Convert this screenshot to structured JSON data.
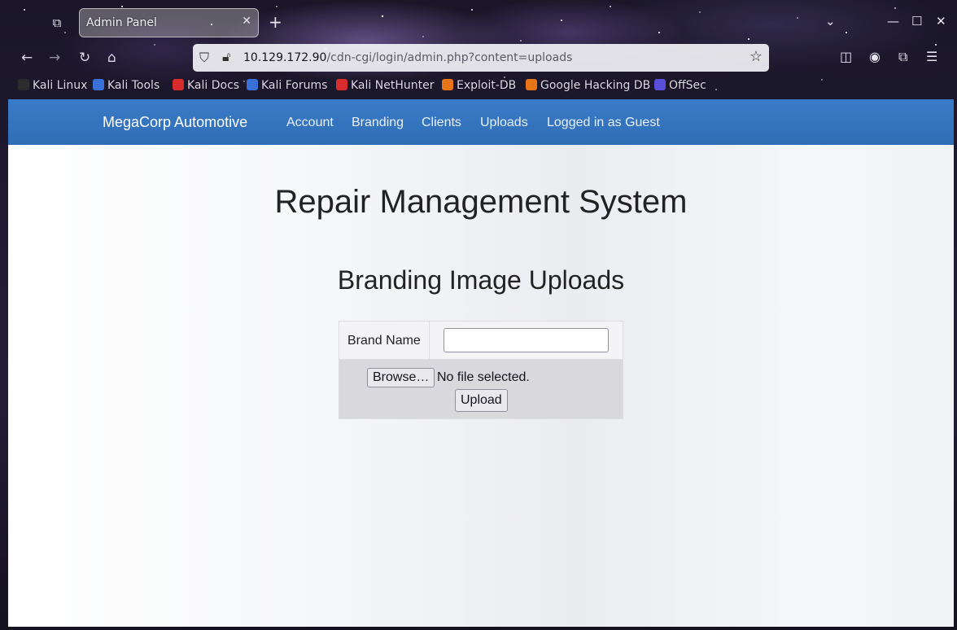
{
  "browser": {
    "tab_title": "Admin Panel",
    "tab_close": "✕",
    "new_tab": "+",
    "url_host": "10.129.172.90",
    "url_path": "/cdn-cgi/login/admin.php?content=uploads",
    "bookmarks": [
      {
        "label": "Kali Linux",
        "color": "#2c2c2c"
      },
      {
        "label": "Kali Tools",
        "color": "#3a6fd8"
      },
      {
        "label": "Kali Docs",
        "color": "#d82c2c"
      },
      {
        "label": "Kali Forums",
        "color": "#3a6fd8"
      },
      {
        "label": "Kali NetHunter",
        "color": "#d82c2c"
      },
      {
        "label": "Exploit-DB",
        "color": "#e8741a"
      },
      {
        "label": "Google Hacking DB",
        "color": "#e8741a"
      },
      {
        "label": "OffSec",
        "color": "#5a4fd8"
      }
    ]
  },
  "site": {
    "brand": "MegaCorp Automotive",
    "nav": [
      "Account",
      "Branding",
      "Clients",
      "Uploads",
      "Logged in as Guest"
    ],
    "nav_color": "#2f6db5",
    "heading": "Repair Management System",
    "subheading": "Branding Image Uploads",
    "form": {
      "brand_label": "Brand Name",
      "brand_value": "",
      "browse_label": "Browse…",
      "file_status": "No file selected.",
      "upload_label": "Upload"
    }
  }
}
